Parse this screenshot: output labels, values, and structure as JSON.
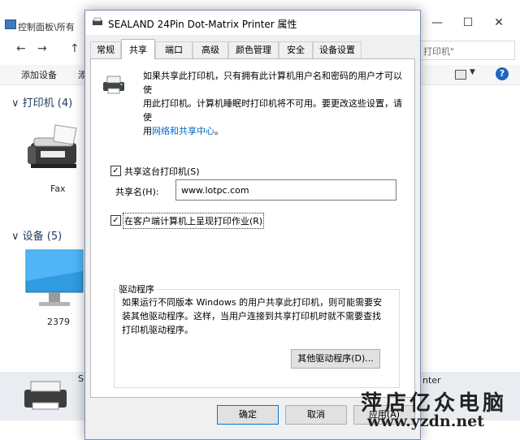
{
  "background": {
    "title": "控制面板\\所有",
    "window_controls": {
      "minimize": "—",
      "maximize": "☐",
      "close": "✕"
    },
    "address_text": "打印机\"",
    "toolbar": {
      "add_device": "添加设备",
      "add_printer": "添"
    },
    "groups": {
      "printers": "打印机 (4)",
      "devices": "设备 (5)"
    },
    "devices": {
      "fax_label": "Fax",
      "monitor_label": "2379"
    },
    "selected_row": {
      "left_text": "S",
      "right_text": "nter"
    },
    "help_glyph": "?",
    "view_arrow": "▼",
    "nav": {
      "back": "←",
      "forward": "→",
      "up": "↑"
    },
    "group_chevron": "∨"
  },
  "dialog": {
    "title": "SEALAND 24Pin Dot-Matrix Printer 属性",
    "tabs": [
      "常规",
      "共享",
      "端口",
      "高级",
      "颜色管理",
      "安全",
      "设备设置"
    ],
    "active_tab": 1,
    "info_line1": "如果共享此打印机，只有拥有此计算机用户名和密码的用户才可以使",
    "info_line2": "用此打印机。计算机睡眠时打印机将不可用。要更改这些设置，请使",
    "info_line3_prefix": "用",
    "info_link": "网络和共享中心",
    "info_line3_suffix": "。",
    "share_checkbox_label": "共享这台打印机(S)",
    "share_checked": true,
    "share_name_label": "共享名(H):",
    "share_name_value": "www.lotpc.com",
    "render_checkbox_label": "在客户端计算机上呈现打印作业(R)",
    "render_checked": true,
    "check_glyph": "✓",
    "drivers": {
      "title": "驱动程序",
      "line1": "如果运行不同版本 Windows 的用户共享此打印机，则可能需要安",
      "line2": "装其他驱动程序。这样，当用户连接到共享打印机时就不需要查找",
      "line3": "打印机驱动程序。",
      "button": "其他驱动程序(D)..."
    },
    "buttons": {
      "ok": "确定",
      "cancel": "取消",
      "apply": "应用(A)"
    }
  },
  "watermark": {
    "line1": "萍店亿众电脑",
    "line2": "www.yzdn.net"
  }
}
